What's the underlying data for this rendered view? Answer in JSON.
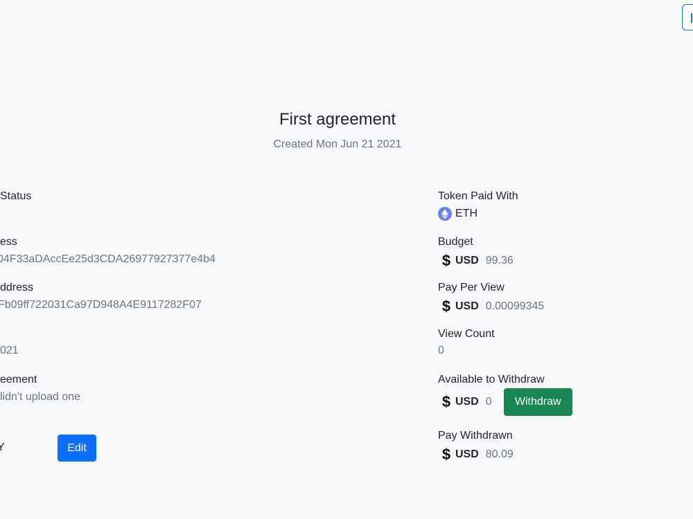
{
  "header": {
    "title": "First agreement",
    "subtitle": "Created Mon Jun 21 2021"
  },
  "left": {
    "status_label": "Status",
    "address_label": "ess",
    "address_value": "04F33aDAccEe25d3CDA26977927377e4b4",
    "address2_label": "ddress",
    "address2_value": "Fb09ff722031Ca97D948A4E9117282F07",
    "date_value": "021",
    "agreement_label": "eement",
    "agreement_value": "lidn't upload one",
    "cut_label": "Y",
    "edit_label": "Edit"
  },
  "right": {
    "token_label": "Token Paid With",
    "token_value": "ETH",
    "token_icon": "ethereum-icon",
    "budget_label": "Budget",
    "budget_currency": "USD",
    "budget_value": "99.36",
    "ppv_label": "Pay Per View",
    "ppv_currency": "USD",
    "ppv_value": "0.00099345",
    "views_label": "View Count",
    "views_value": "0",
    "avail_label": "Available to Withdraw",
    "avail_currency": "USD",
    "avail_value": "0",
    "withdraw_label": "Withdraw",
    "withdrawn_label": "Pay Withdrawn",
    "withdrawn_currency": "USD",
    "withdrawn_value": "80.09",
    "dollar_symbol": "$"
  },
  "colors": {
    "primary": "#0d6efd",
    "success": "#198754",
    "background": "#f8f9fa",
    "muted": "#6c757d"
  }
}
